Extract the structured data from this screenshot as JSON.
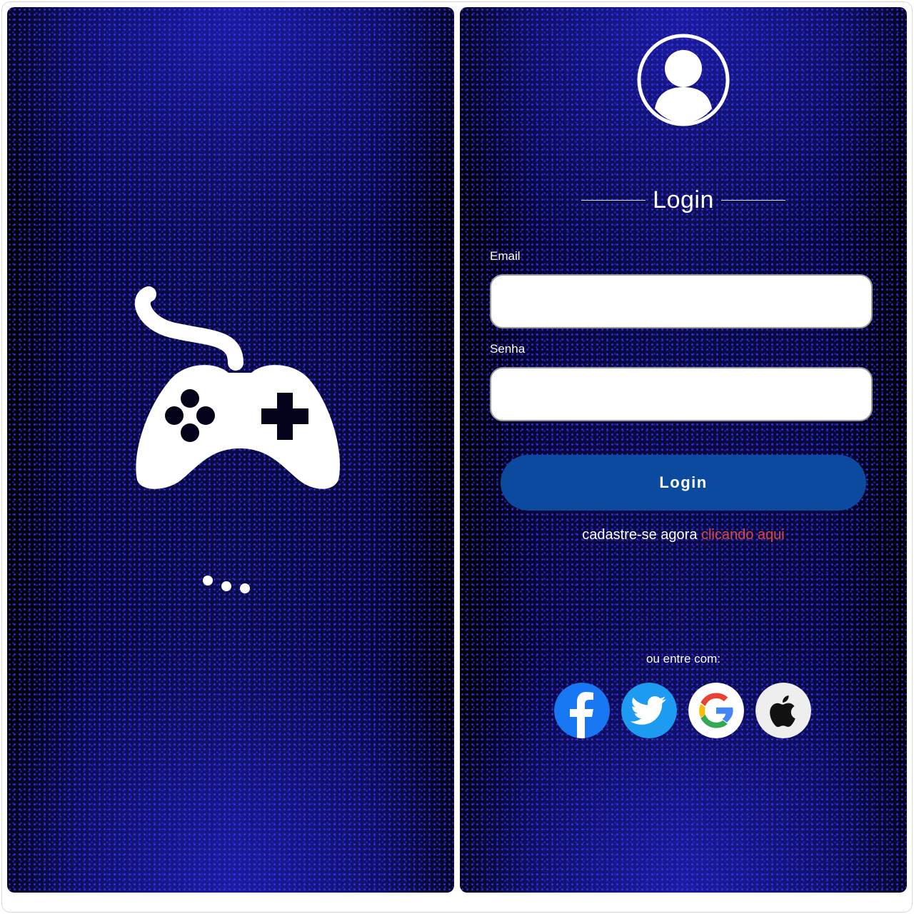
{
  "splash": {
    "logo_icon": "gamepad-icon",
    "loading_icon": "loading-dots-icon"
  },
  "login": {
    "avatar_icon": "user-avatar-icon",
    "title": "Login",
    "email_label": "Email",
    "email_value": "",
    "password_label": "Senha",
    "password_value": "",
    "button_label": "Login",
    "register_text": "cadastre-se agora",
    "register_link": "clicando aqui",
    "alt_login_text": "ou entre com:",
    "social": [
      {
        "name": "facebook-icon",
        "color": "#1877f2"
      },
      {
        "name": "twitter-icon",
        "color": "#1d9bf0"
      },
      {
        "name": "google-icon",
        "color": "#ffffff"
      },
      {
        "name": "apple-icon",
        "color": "#eeeeee"
      }
    ]
  },
  "colors": {
    "accent": "#0b4a9f",
    "link": "#e0473a",
    "background": "#02020e"
  }
}
